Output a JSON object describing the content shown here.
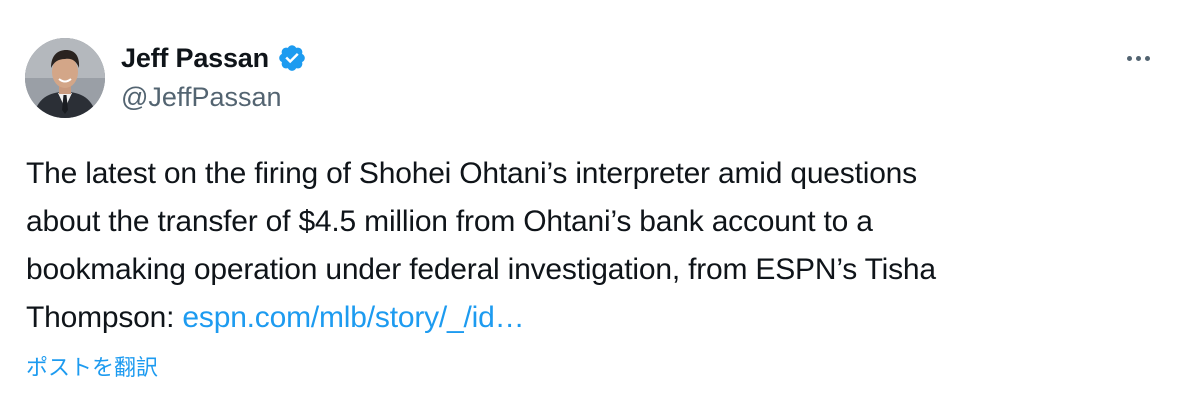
{
  "author": {
    "display_name": "Jeff Passan",
    "handle": "@JeffPassan",
    "verified": true,
    "avatar_icon": "profile-photo"
  },
  "tweet": {
    "lines": [
      "The latest on the firing of Shohei Ohtani’s interpreter amid questions",
      "about the transfer of $4.5 million from Ohtani’s bank account to a",
      "bookmaking operation under federal investigation,  from ESPN’s Tisha"
    ],
    "last_line_prefix": "Thompson: ",
    "link_text": "espn.com/mlb/story/_/id…"
  },
  "actions": {
    "translate_label": "ポストを翻訳",
    "more_icon": "more-horizontal-icon"
  },
  "colors": {
    "link": "#1d9bf0",
    "text": "#0f1419",
    "secondary": "#536471",
    "verified": "#1d9bf0"
  }
}
